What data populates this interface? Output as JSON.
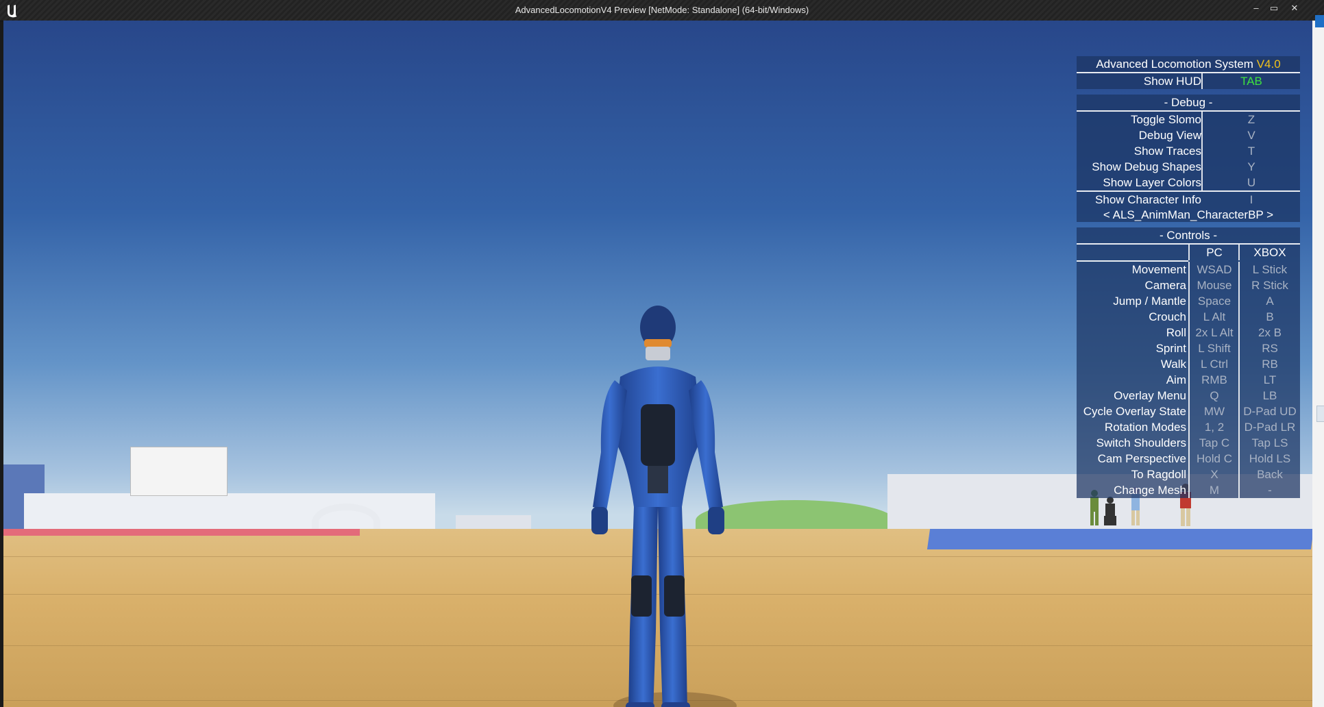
{
  "window": {
    "title": "AdvancedLocomotionV4 Preview [NetMode: Standalone]  (64-bit/Windows)",
    "minimize": "–",
    "maximize": "▭",
    "close": "✕"
  },
  "hud": {
    "title_text": "Advanced Locomotion System ",
    "version": "V4.0",
    "show_hud_label": "Show HUD",
    "show_hud_key": "TAB",
    "debug_header": "- Debug -",
    "debug_items": [
      {
        "label": "Toggle Slomo",
        "key": "Z"
      },
      {
        "label": "Debug View",
        "key": "V"
      },
      {
        "label": "Show Traces",
        "key": "T"
      },
      {
        "label": "Show Debug Shapes",
        "key": "Y"
      },
      {
        "label": "Show Layer Colors",
        "key": "U"
      }
    ],
    "char_info_label": "Show Character Info",
    "char_info_key": "I",
    "character_selector": "<  ALS_AnimMan_CharacterBP  >",
    "controls_header": "- Controls -",
    "pc_header": "PC",
    "xbox_header": "XBOX",
    "controls": [
      {
        "label": "Movement",
        "pc": "WSAD",
        "xbox": "L Stick"
      },
      {
        "label": "Camera",
        "pc": "Mouse",
        "xbox": "R Stick"
      },
      {
        "label": "Jump / Mantle",
        "pc": "Space",
        "xbox": "A"
      },
      {
        "label": "Crouch",
        "pc": "L Alt",
        "xbox": "B"
      },
      {
        "label": "Roll",
        "pc": "2x L Alt",
        "xbox": "2x B"
      },
      {
        "label": "Sprint",
        "pc": "L Shift",
        "xbox": "RS"
      },
      {
        "label": "Walk",
        "pc": "L Ctrl",
        "xbox": "RB"
      },
      {
        "label": "Aim",
        "pc": "RMB",
        "xbox": "LT"
      },
      {
        "label": "Overlay Menu",
        "pc": "Q",
        "xbox": "LB"
      },
      {
        "label": "Cycle Overlay State",
        "pc": "MW",
        "xbox": "D-Pad UD"
      },
      {
        "label": "Rotation Modes",
        "pc": "1, 2",
        "xbox": "D-Pad LR"
      },
      {
        "label": "Switch Shoulders",
        "pc": "Tap C",
        "xbox": "Tap LS"
      },
      {
        "label": "Cam Perspective",
        "pc": "Hold C",
        "xbox": "Hold LS"
      },
      {
        "label": "To Ragdoll",
        "pc": "X",
        "xbox": "Back"
      },
      {
        "label": "Change Mesh",
        "pc": "M",
        "xbox": "-"
      }
    ],
    "colors": {
      "version": "#f2c21b",
      "tab_key": "#3ee13e",
      "key_text": "#a9b3c4",
      "panel": "#1c3462"
    }
  }
}
